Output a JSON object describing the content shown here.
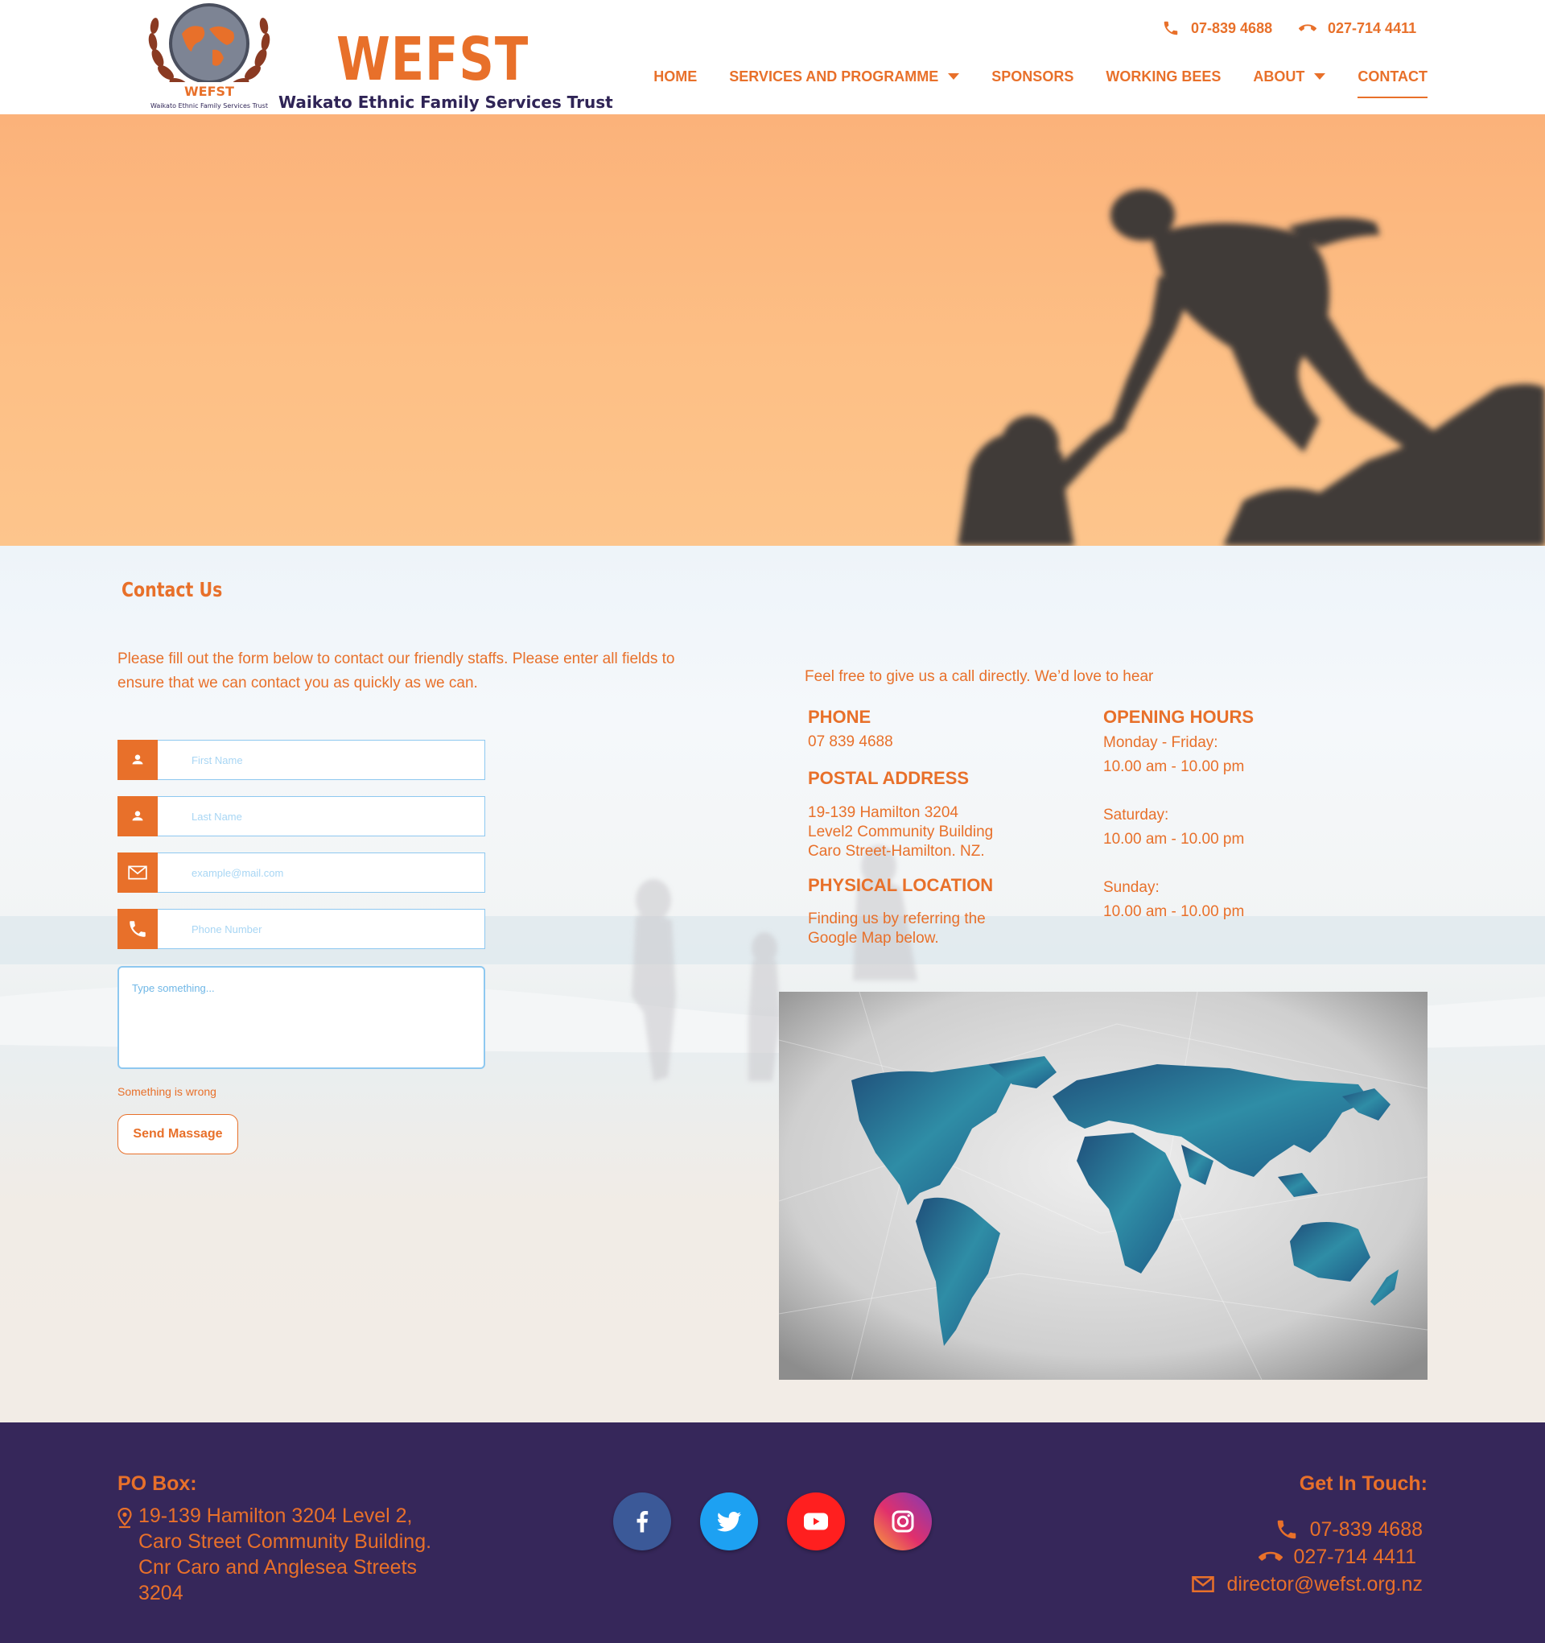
{
  "header": {
    "logo_badge_text": "WEFST",
    "logo_badge_subtext": "Waikato Ethnic Family Services Trust",
    "logo_word": "WEFST",
    "logo_subtitle": "Waikato Ethnic Family Services Trust",
    "phone_1": "07-839 4688",
    "phone_2": "027-714 4411",
    "phone_1_icon": "phone-icon",
    "phone_2_icon": "phone-hangup-icon"
  },
  "nav": {
    "items": [
      {
        "label": "HOME",
        "dropdown": false,
        "active": false
      },
      {
        "label": "SERVICES AND PROGRAMME",
        "dropdown": true,
        "active": false
      },
      {
        "label": "SPONSORS",
        "dropdown": false,
        "active": false
      },
      {
        "label": "WORKING BEES",
        "dropdown": false,
        "active": false
      },
      {
        "label": "ABOUT",
        "dropdown": true,
        "active": false
      },
      {
        "label": "CONTACT",
        "dropdown": false,
        "active": true
      }
    ]
  },
  "contact": {
    "title": "Contact Us",
    "intro": "Please fill out the form below to contact our friendly staffs. Please enter all fields to ensure that we can contact you as quickly as we can.",
    "form": {
      "first_name_placeholder": "First Name",
      "first_name_value": "",
      "last_name_placeholder": "Last Name",
      "last_name_value": "",
      "email_placeholder": "example@mail.com",
      "email_value": "",
      "phone_placeholder": "Phone Number",
      "phone_value": "",
      "message_placeholder": "Type something...",
      "message_value": "",
      "error_text": "Something is wrong",
      "submit_label": "Send Massage"
    },
    "call_intro": "Feel free to give us a call directly. We’d love to hear",
    "phone_heading": "PHONE",
    "phone_value": "07 839 4688",
    "postal_heading": "POSTAL ADDRESS",
    "postal_lines": [
      "19-139 Hamilton 3204",
      "Level2 Community Building",
      "Caro Street-Hamilton. NZ."
    ],
    "physical_heading": "PHYSICAL LOCATION",
    "physical_lines": [
      "Finding us by referring the",
      "Google Map below."
    ],
    "hours_heading": "OPENING HOURS",
    "hours": [
      {
        "day": "Monday - Friday:",
        "time": "10.00 am - 10.00 pm"
      },
      {
        "day": "Saturday:",
        "time": "10.00 am - 10.00 pm"
      },
      {
        "day": "Sunday:",
        "time": "10.00 am - 10.00 pm"
      }
    ]
  },
  "footer": {
    "po_heading": "PO Box:",
    "po_address": "19-139 Hamilton 3204 Level 2, Caro Street Community Building. Cnr Caro and Anglesea Streets 3204",
    "social": [
      {
        "name": "facebook-icon",
        "color": "#3b5998"
      },
      {
        "name": "twitter-icon",
        "color": "#1da1f2"
      },
      {
        "name": "youtube-icon",
        "color": "#ff0000"
      },
      {
        "name": "instagram-icon",
        "color": "#c13584"
      }
    ],
    "touch_heading": "Get In Touch:",
    "touch_phone_1": "07-839 4688",
    "touch_phone_2": "027-714 4411",
    "touch_email": "director@wefst.org.nz"
  },
  "colors": {
    "accent": "#e8702a",
    "footer_bg": "#36275a",
    "field_border": "#8ec8f0"
  }
}
